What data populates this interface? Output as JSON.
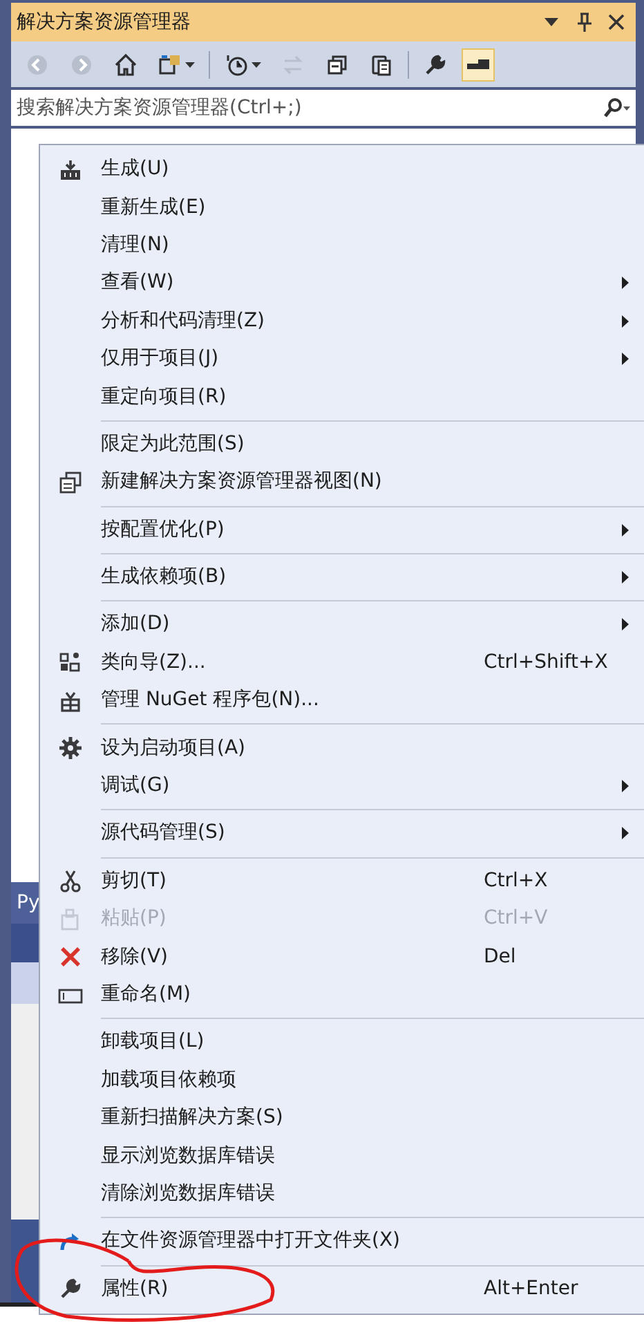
{
  "window": {
    "title": "解决方案资源管理器"
  },
  "toolbar_buttons": [
    {
      "disabled": true,
      "selected": false
    },
    {
      "disabled": true,
      "selected": false
    },
    {
      "disabled": false,
      "selected": false
    },
    {
      "disabled": false,
      "selected": false
    },
    {
      "disabled": false,
      "selected": false
    },
    {
      "disabled": true,
      "selected": false
    },
    {
      "disabled": false,
      "selected": false
    },
    {
      "disabled": false,
      "selected": false
    },
    {
      "disabled": false,
      "selected": false
    },
    {
      "disabled": false,
      "selected": true
    }
  ],
  "search": {
    "placeholder": "搜索解决方案资源管理器(Ctrl+;)"
  },
  "side_tab": "Py",
  "context_menu": [
    {
      "kind": "item",
      "label": "生成(U)",
      "disabled": false,
      "submenu": false
    },
    {
      "kind": "item",
      "label": "重新生成(E)",
      "disabled": false,
      "submenu": false
    },
    {
      "kind": "item",
      "label": "清理(N)",
      "disabled": false,
      "submenu": false
    },
    {
      "kind": "item",
      "label": "查看(W)",
      "disabled": false,
      "submenu": true
    },
    {
      "kind": "item",
      "label": "分析和代码清理(Z)",
      "disabled": false,
      "submenu": true
    },
    {
      "kind": "item",
      "label": "仅用于项目(J)",
      "disabled": false,
      "submenu": true
    },
    {
      "kind": "item",
      "label": "重定向项目(R)",
      "disabled": false,
      "submenu": false
    },
    {
      "kind": "separator"
    },
    {
      "kind": "item",
      "label": "限定为此范围(S)",
      "disabled": false,
      "submenu": false
    },
    {
      "kind": "item",
      "label": "新建解决方案资源管理器视图(N)",
      "disabled": false,
      "submenu": false
    },
    {
      "kind": "separator"
    },
    {
      "kind": "item",
      "label": "按配置优化(P)",
      "disabled": false,
      "submenu": true
    },
    {
      "kind": "separator"
    },
    {
      "kind": "item",
      "label": "生成依赖项(B)",
      "disabled": false,
      "submenu": true
    },
    {
      "kind": "separator"
    },
    {
      "kind": "item",
      "label": "添加(D)",
      "disabled": false,
      "submenu": true
    },
    {
      "kind": "item",
      "label": "类向导(Z)...",
      "shortcut": "Ctrl+Shift+X",
      "disabled": false,
      "submenu": false
    },
    {
      "kind": "item",
      "label": "管理 NuGet 程序包(N)...",
      "disabled": false,
      "submenu": false
    },
    {
      "kind": "separator"
    },
    {
      "kind": "item",
      "label": "设为启动项目(A)",
      "disabled": false,
      "submenu": false
    },
    {
      "kind": "item",
      "label": "调试(G)",
      "disabled": false,
      "submenu": true
    },
    {
      "kind": "separator"
    },
    {
      "kind": "item",
      "label": "源代码管理(S)",
      "disabled": false,
      "submenu": true
    },
    {
      "kind": "separator"
    },
    {
      "kind": "item",
      "label": "剪切(T)",
      "shortcut": "Ctrl+X",
      "disabled": false,
      "submenu": false
    },
    {
      "kind": "item",
      "label": "粘贴(P)",
      "shortcut": "Ctrl+V",
      "disabled": true,
      "submenu": false
    },
    {
      "kind": "item",
      "label": "移除(V)",
      "shortcut": "Del",
      "disabled": false,
      "submenu": false
    },
    {
      "kind": "item",
      "label": "重命名(M)",
      "disabled": false,
      "submenu": false
    },
    {
      "kind": "separator"
    },
    {
      "kind": "item",
      "label": "卸载项目(L)",
      "disabled": false,
      "submenu": false
    },
    {
      "kind": "item",
      "label": "加载项目依赖项",
      "disabled": false,
      "submenu": false
    },
    {
      "kind": "item",
      "label": "重新扫描解决方案(S)",
      "disabled": false,
      "submenu": false
    },
    {
      "kind": "item",
      "label": "显示浏览数据库错误",
      "disabled": false,
      "submenu": false
    },
    {
      "kind": "item",
      "label": "清除浏览数据库错误",
      "disabled": false,
      "submenu": false
    },
    {
      "kind": "separator"
    },
    {
      "kind": "item",
      "label": "在文件资源管理器中打开文件夹(X)",
      "disabled": false,
      "submenu": false
    },
    {
      "kind": "separator"
    },
    {
      "kind": "item",
      "label": "属性(R)",
      "shortcut": "Alt+Enter",
      "disabled": false,
      "submenu": false
    }
  ]
}
